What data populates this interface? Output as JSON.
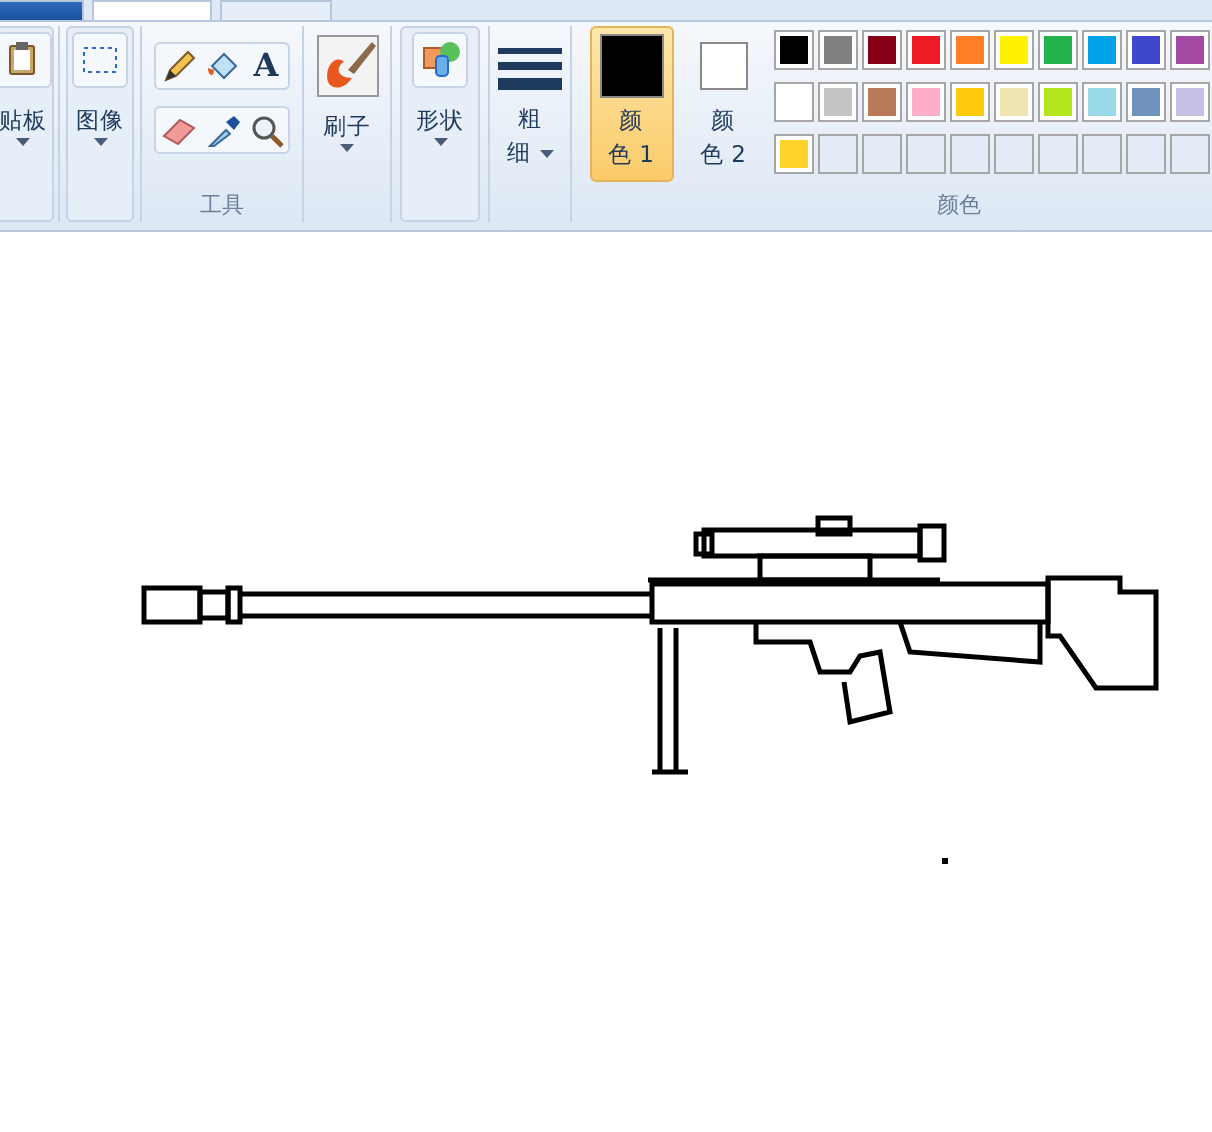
{
  "tabs": [
    {
      "selected": true
    },
    {
      "selected": false
    }
  ],
  "groups": [
    {
      "kind": "clipboard",
      "label": "贴板"
    },
    {
      "kind": "image",
      "label": "图像"
    },
    {
      "kind": "tools",
      "label": "工具",
      "text_tool": "A"
    },
    {
      "kind": "brush",
      "label": "刷子"
    },
    {
      "kind": "shapes",
      "label": "形状"
    },
    {
      "kind": "size",
      "label": "粗细"
    }
  ],
  "colors": {
    "slots": [
      {
        "label1": "颜",
        "label2": "色 1",
        "color": "#000000",
        "selected": true
      },
      {
        "label1": "颜",
        "label2": "色 2",
        "color": "#ffffff",
        "selected": false
      }
    ],
    "palette": [
      {
        "color": "#000000"
      },
      {
        "color": "#7f7f7f"
      },
      {
        "color": "#880015"
      },
      {
        "color": "#ed1c24"
      },
      {
        "color": "#ff7f27"
      },
      {
        "color": "#fff200"
      },
      {
        "color": "#22b14c"
      },
      {
        "color": "#00a2e8"
      },
      {
        "color": "#3f48cc"
      },
      {
        "color": "#a349a4"
      },
      {
        "color": "#ffffff"
      },
      {
        "color": "#c3c3c3"
      },
      {
        "color": "#b97a57"
      },
      {
        "color": "#ffaec9"
      },
      {
        "color": "#ffc90e"
      },
      {
        "color": "#efe4b0"
      },
      {
        "color": "#b5e61d"
      },
      {
        "color": "#99d9ea"
      },
      {
        "color": "#7092be"
      },
      {
        "color": "#c8bfe7"
      },
      {
        "color": "#ffd42a"
      },
      {
        "kind": "empty"
      },
      {
        "kind": "empty"
      },
      {
        "kind": "empty"
      },
      {
        "kind": "empty"
      },
      {
        "kind": "empty"
      },
      {
        "kind": "empty"
      },
      {
        "kind": "empty"
      },
      {
        "kind": "empty"
      },
      {
        "kind": "empty"
      }
    ],
    "label": "颜色"
  }
}
